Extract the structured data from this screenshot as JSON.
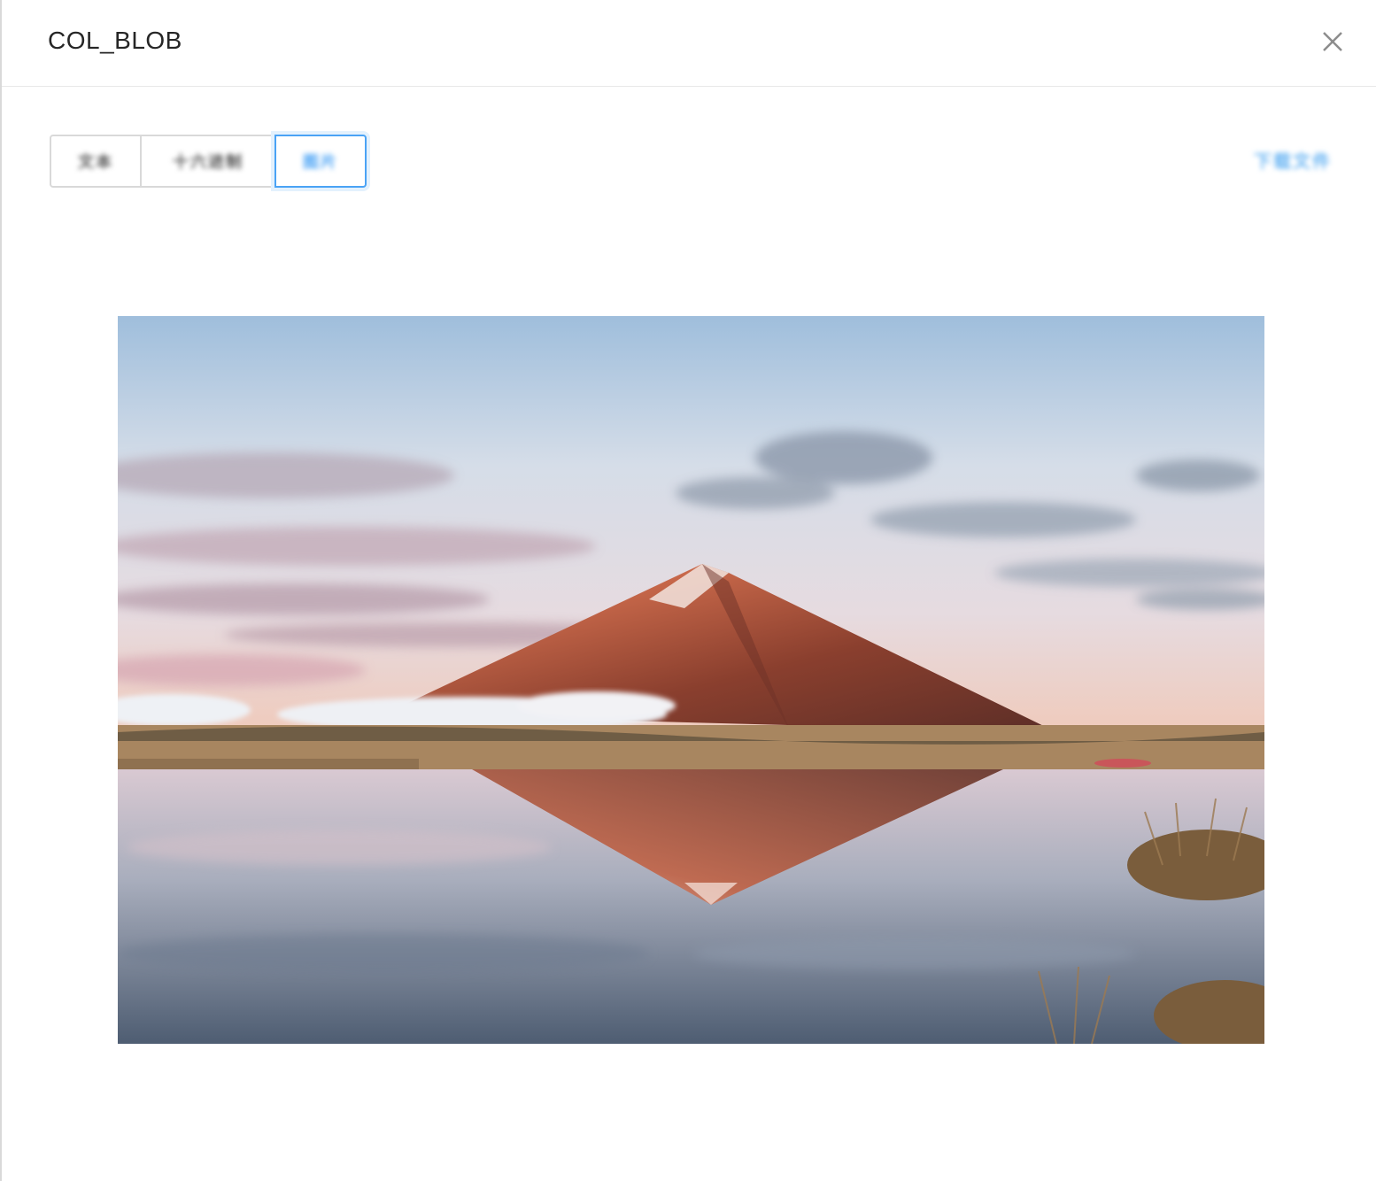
{
  "dialog": {
    "title": "COL_BLOB",
    "close_icon": "close-icon"
  },
  "tabs": [
    {
      "label": "文本",
      "active": false
    },
    {
      "label": "十六进制",
      "active": false
    },
    {
      "label": "图片",
      "active": true
    }
  ],
  "toolbar": {
    "action_label": "下载文件"
  },
  "preview": {
    "kind": "image",
    "subject": "mountain-lake-reflection"
  },
  "colors": {
    "accent": "#4aa3f5",
    "border": "#d9d9d9",
    "title_text": "#262626"
  }
}
